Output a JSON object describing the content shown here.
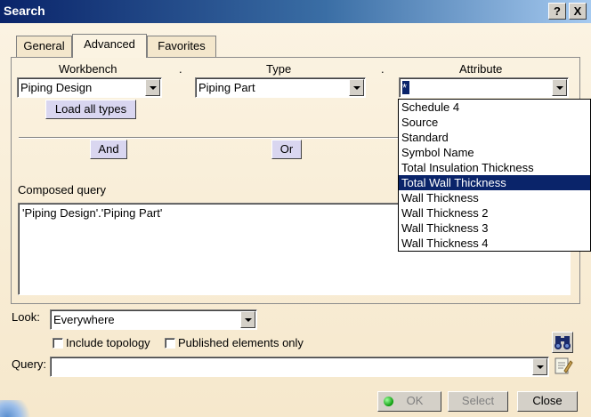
{
  "window": {
    "title": "Search",
    "help_glyph": "?",
    "close_glyph": "X"
  },
  "tabs": [
    {
      "label": "General"
    },
    {
      "label": "Advanced"
    },
    {
      "label": "Favorites"
    }
  ],
  "active_tab": "Advanced",
  "filters": {
    "workbench_label": "Workbench",
    "workbench_value": "Piping Design",
    "dot1": ".",
    "type_label": "Type",
    "type_value": "Piping Part",
    "dot2": ".",
    "attribute_label": "Attribute",
    "attribute_value": "*"
  },
  "load_all_types_label": "Load all types",
  "and_label": "And",
  "or_label": "Or",
  "composed_query_label": "Composed query",
  "composed_query_value": "'Piping Design'.'Piping Part'",
  "attribute_options": [
    "Schedule 4",
    "Source",
    "Standard",
    "Symbol Name",
    "Total Insulation Thickness",
    "Total Wall Thickness",
    "Wall Thickness",
    "Wall Thickness 2",
    "Wall Thickness 3",
    "Wall Thickness 4"
  ],
  "attribute_selected": "Total Wall Thickness",
  "look": {
    "label": "Look:",
    "value": "Everywhere"
  },
  "include_topology_label": "Include topology",
  "published_only_label": "Published elements only",
  "query": {
    "label": "Query:",
    "value": ""
  },
  "footer": {
    "ok_label": "OK",
    "select_label": "Select",
    "close_label": "Close"
  },
  "icons": {
    "search": "binoculars-icon",
    "favorite": "notepad-icon"
  }
}
